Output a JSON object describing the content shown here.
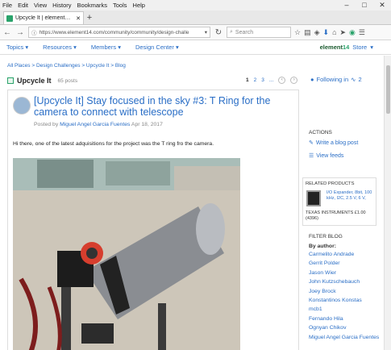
{
  "menubar": {
    "items": [
      "File",
      "Edit",
      "View",
      "History",
      "Bookmarks",
      "Tools",
      "Help"
    ]
  },
  "tab": {
    "title": "Upcycle It | element14 | U..."
  },
  "address": {
    "url": "https://www.element14.com/community/community/design-challe",
    "search_placeholder": "Search"
  },
  "sitenav": {
    "items": [
      "Topics",
      "Resources",
      "Members",
      "Design Center"
    ],
    "logo_a": "element",
    "logo_b": "14",
    "store": "Store"
  },
  "breadcrumb": "All Places > Design Challenges > Upcycle It > Blog",
  "blog": {
    "title": "Upcycle It",
    "count": "65 posts",
    "pages": [
      "1",
      "2",
      "3",
      "..."
    ]
  },
  "following": {
    "label": "Following in",
    "count": "2"
  },
  "post": {
    "title": "[Upcycle It] Stay focused in the sky #3: T Ring for the camera to connect with telescope",
    "posted_by": "Posted by",
    "author": "Miguel Angel Garcia Fuentes",
    "date": "Apr 18, 2017",
    "body": "Hi there, one of the latest adquisitions for the project was the T ring fro the camera."
  },
  "actions": {
    "heading": "ACTIONS",
    "write": "Write a blog post",
    "view": "View feeds"
  },
  "related": {
    "heading": "RELATED PRODUCTS",
    "desc": "I/O Expander, 8bit, 100 kHz, I2C, 2.5 V, 6 V,",
    "vendor": "TEXAS INSTRUMENTS £1.00 (4396)"
  },
  "filter": {
    "heading": "FILTER BLOG",
    "by_author": "By author:",
    "authors": [
      "Carmelito Andrade",
      "Gerrit Polder",
      "Jason Wier",
      "John Kutzschebauch",
      "Joey Brock",
      "Konstantinos Konstas",
      "mcb1",
      "Fernando Hila",
      "Ognyan Chikov",
      "Miguel Angel Garcia Fuentes"
    ]
  },
  "colors": {
    "link": "#2a6ec6",
    "brand": "#2aa36b"
  }
}
